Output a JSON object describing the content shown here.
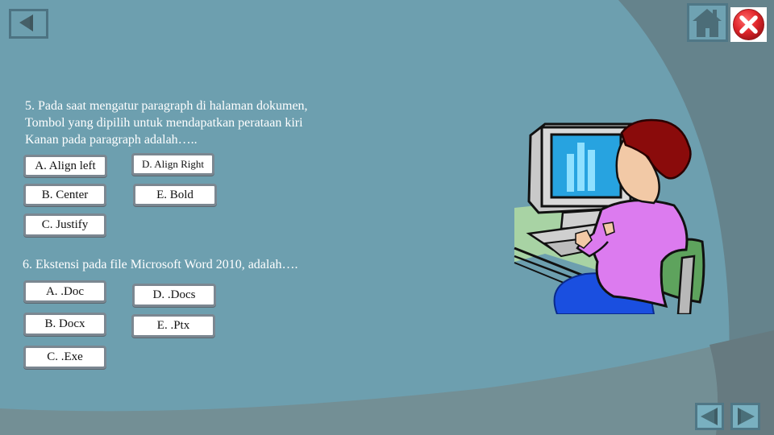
{
  "nav": {
    "back_icon": "triangle-left-icon",
    "home_icon": "home-icon",
    "close_icon": "close-icon",
    "prev_icon": "triangle-left-icon",
    "next_icon": "triangle-right-icon"
  },
  "questions": [
    {
      "number": "5.",
      "lines": [
        "5. Pada saat mengatur paragraph di halaman dokumen,",
        "Tombol yang dipilih untuk mendapatkan perataan kiri",
        "Kanan pada paragraph adalah….."
      ],
      "options": [
        {
          "label": "A. Align left"
        },
        {
          "label": "B. Center"
        },
        {
          "label": "C. Justify"
        },
        {
          "label": "D. Align Right"
        },
        {
          "label": "E. Bold"
        }
      ]
    },
    {
      "number": "6.",
      "lines": [
        "6.  Ekstensi pada file Microsoft Word  2010, adalah…."
      ],
      "options": [
        {
          "label": "A. .Doc"
        },
        {
          "label": "B. Docx"
        },
        {
          "label": "C. .Exe"
        },
        {
          "label": "D. .Docs"
        },
        {
          "label": "E. .Ptx"
        }
      ]
    }
  ],
  "illustration": "woman-at-computer-clipart",
  "colors": {
    "background": "#6d9faf",
    "dark_band": "#65838c",
    "bottom_band": "#748e94",
    "close_red": "#e0262b"
  }
}
